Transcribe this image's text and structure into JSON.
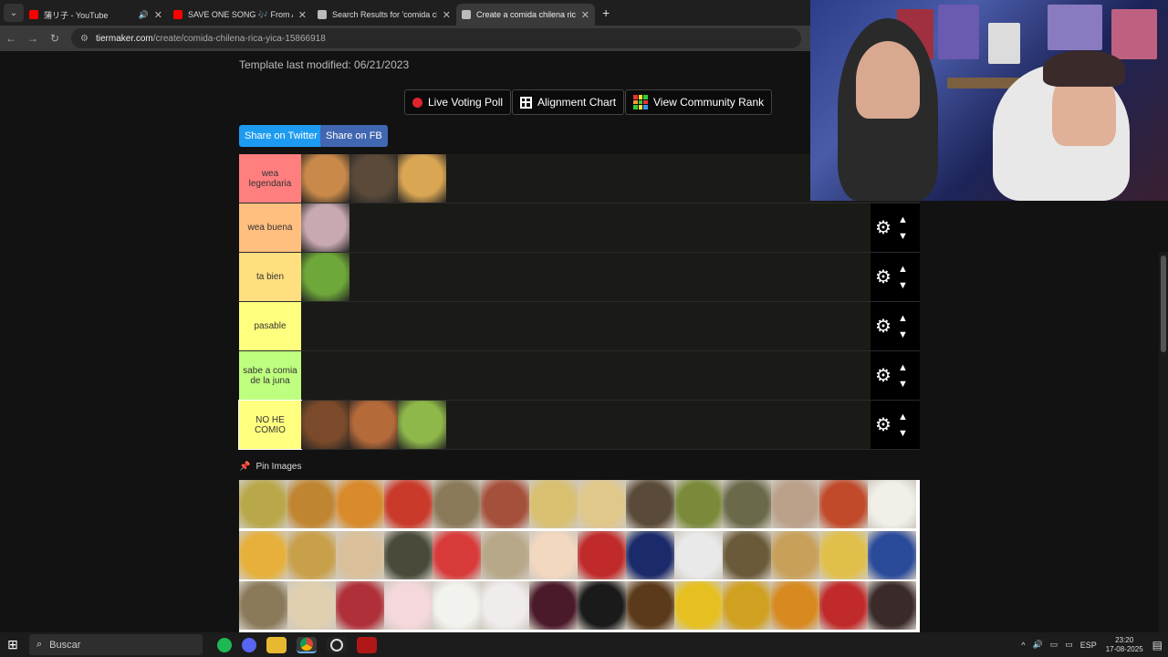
{
  "browser": {
    "tabs": [
      {
        "title": "蒲リ子 - YouTube",
        "fav_color": "#ff0000",
        "active": false,
        "audio": false
      },
      {
        "title": "SAVE ONE SONG 🎶 From A to",
        "fav_color": "#ff0000",
        "active": false,
        "audio": false
      },
      {
        "title": "Search Results for 'comida chile",
        "fav_color": "#bbbbbb",
        "active": false,
        "audio": false
      },
      {
        "title": "Create a comida chilena rica yic",
        "fav_color": "#bbbbbb",
        "active": true,
        "audio": false
      }
    ],
    "close_glyph": "✕",
    "new_tab_glyph": "+",
    "url_domain": "tiermaker.com",
    "url_path": "/create/comida-chilena-rica-yica-15866918"
  },
  "page": {
    "template_modified": "Template last modified: 06/21/2023",
    "buttons": {
      "live_poll": "Live Voting Poll",
      "alignment": "Alignment Chart",
      "community": "View Community Rank"
    },
    "share": {
      "twitter": "Share on Twitter",
      "fb": "Share on FB"
    },
    "tiers": [
      {
        "label": "wea legendaria",
        "color": "#ff7f7f",
        "items": [
          "#c8894a",
          "#5b4a3a",
          "#d9a654"
        ]
      },
      {
        "label": "wea buena",
        "color": "#ffbf7f",
        "items": [
          "#c9a9b0"
        ]
      },
      {
        "label": "ta bien",
        "color": "#ffdf7f",
        "items": [
          "#6fa83a"
        ]
      },
      {
        "label": "pasable",
        "color": "#ffff7f",
        "items": []
      },
      {
        "label": "sabe a comia de la juna",
        "color": "#bfff7f",
        "items": []
      },
      {
        "label": "NO HE COMIO",
        "color": "#ffff7f",
        "items": [
          "#7a4a2a",
          "#b56a3a",
          "#8fb84a"
        ]
      }
    ],
    "pin_images": "Pin Images",
    "pool_colors": [
      "#b9a84a",
      "#c08530",
      "#d98a2a",
      "#c93a2a",
      "#8a7a5a",
      "#a5503a",
      "#d8c070",
      "#e0c78a",
      "#5a4a3a",
      "#7a8a3a",
      "#6a6a4a",
      "#bba08a",
      "#c04a2a",
      "#f0f0e8",
      "#e6b03a",
      "#c9a04a",
      "#d9c09a",
      "#4a4a3a",
      "#d83a3a",
      "#b8a88a",
      "#f3d8c0",
      "#c02a2a",
      "#1a2a6a",
      "#e9e9e9",
      "#6a5a3a",
      "#c8a05a",
      "#e0c04a",
      "#2a4a9a",
      "#8a7a5a",
      "#e0d0b0",
      "#b0303a",
      "#f4d8dc",
      "#f2f2ee",
      "#f0ecec",
      "#4a1a2a",
      "#1a1a1a",
      "#5a3a1a",
      "#e6c020",
      "#d0a020",
      "#d88a20",
      "#c02a2a",
      "#3a2a2a"
    ]
  },
  "taskbar": {
    "search_placeholder": "Buscar",
    "lang": "ESP",
    "time": "23:20",
    "date": "17-08-2025"
  }
}
